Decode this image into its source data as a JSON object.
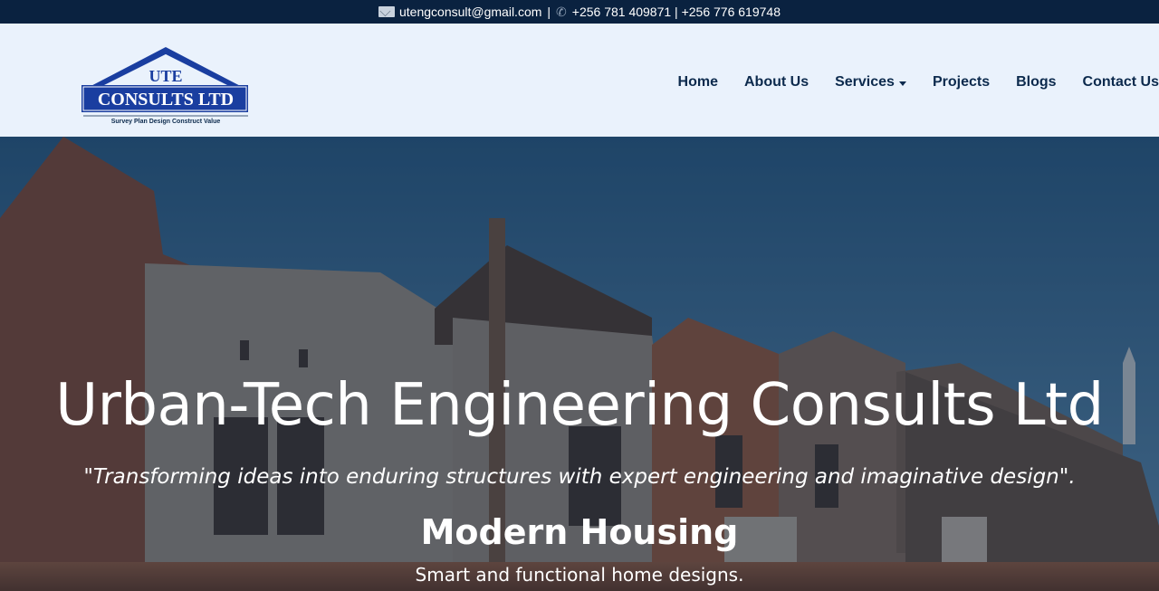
{
  "topbar": {
    "email": "utengconsult@gmail.com",
    "separator": "|",
    "phones": "+256 781 409871 | +256 776 619748",
    "mail_icon": "envelope-icon",
    "phone_icon": "phone-icon"
  },
  "logo": {
    "line1": "UTE",
    "line2": "CONSULTS LTD",
    "slogan": "Survey Plan Design Construct Value",
    "colors": {
      "blue": "#1a3ea0",
      "navy": "#0c2a4d"
    }
  },
  "nav": {
    "items": [
      {
        "label": "Home"
      },
      {
        "label": "About Us"
      },
      {
        "label": "Services",
        "has_dropdown": true
      },
      {
        "label": "Projects"
      },
      {
        "label": "Blogs"
      },
      {
        "label": "Contact Us"
      }
    ],
    "color": "#0c2a4d"
  },
  "hero": {
    "title": "Urban-Tech Engineering Consults Ltd",
    "tagline": "\"Transforming ideas into enduring structures with expert engineering and imaginative design\".",
    "slide_title": "Modern Housing",
    "slide_desc": "Smart and functional home designs."
  },
  "colors": {
    "topbar_bg": "#0a2240",
    "header_bg": "#eaf2fc",
    "hero_sky": "#2f5f86"
  }
}
